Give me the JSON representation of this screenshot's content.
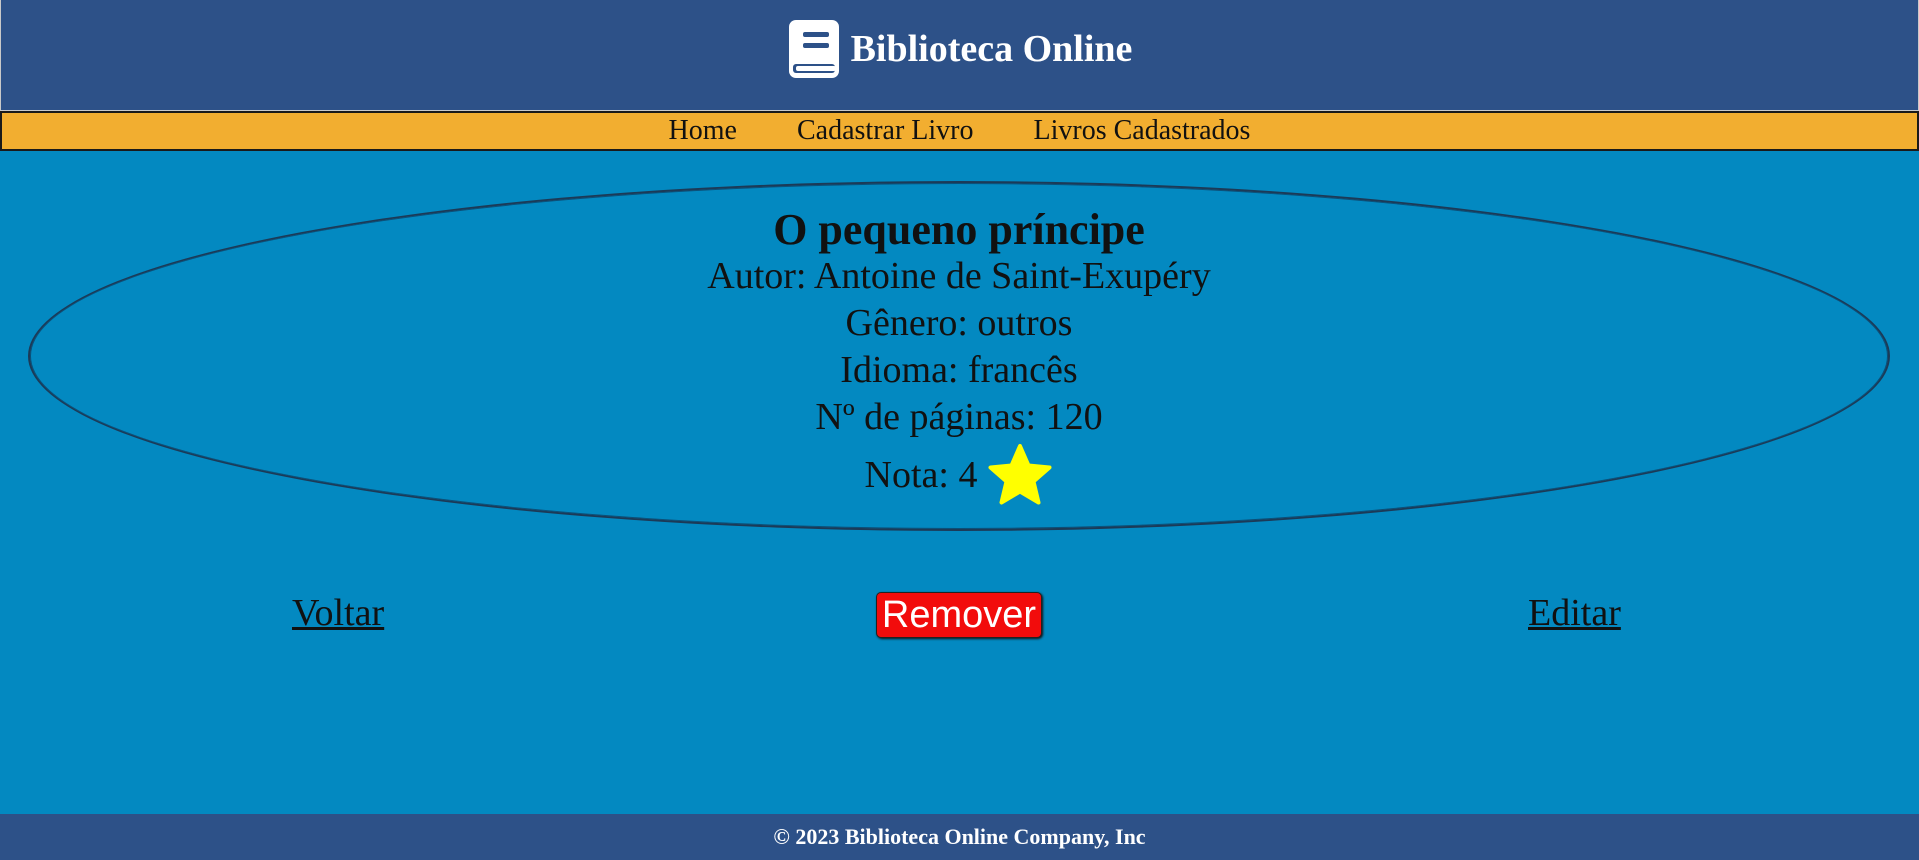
{
  "header": {
    "title": "Biblioteca Online",
    "logo_icon": "book-icon"
  },
  "nav": {
    "items": [
      {
        "label": "Home"
      },
      {
        "label": "Cadastrar Livro"
      },
      {
        "label": "Livros Cadastrados"
      }
    ]
  },
  "book": {
    "title": "O pequeno príncipe",
    "author_line": "Autor: Antoine de Saint-Exupéry",
    "genre_line": "Gênero: outros",
    "language_line": "Idioma: francês",
    "pages_line": "Nº de páginas: 120",
    "rating_line": "Nota: 4",
    "rating_icon": "star-icon",
    "rating_value": 4
  },
  "actions": {
    "back_label": "Voltar",
    "remove_label": "Remover",
    "edit_label": "Editar"
  },
  "footer": {
    "copyright": "© 2023 Biblioteca Online Company, Inc"
  },
  "colors": {
    "header_bg": "#2d5188",
    "nav_bg": "#f2ae30",
    "page_bg": "#0389c1",
    "remove_button_bg": "#f20c0c",
    "star": "#ffff00"
  }
}
